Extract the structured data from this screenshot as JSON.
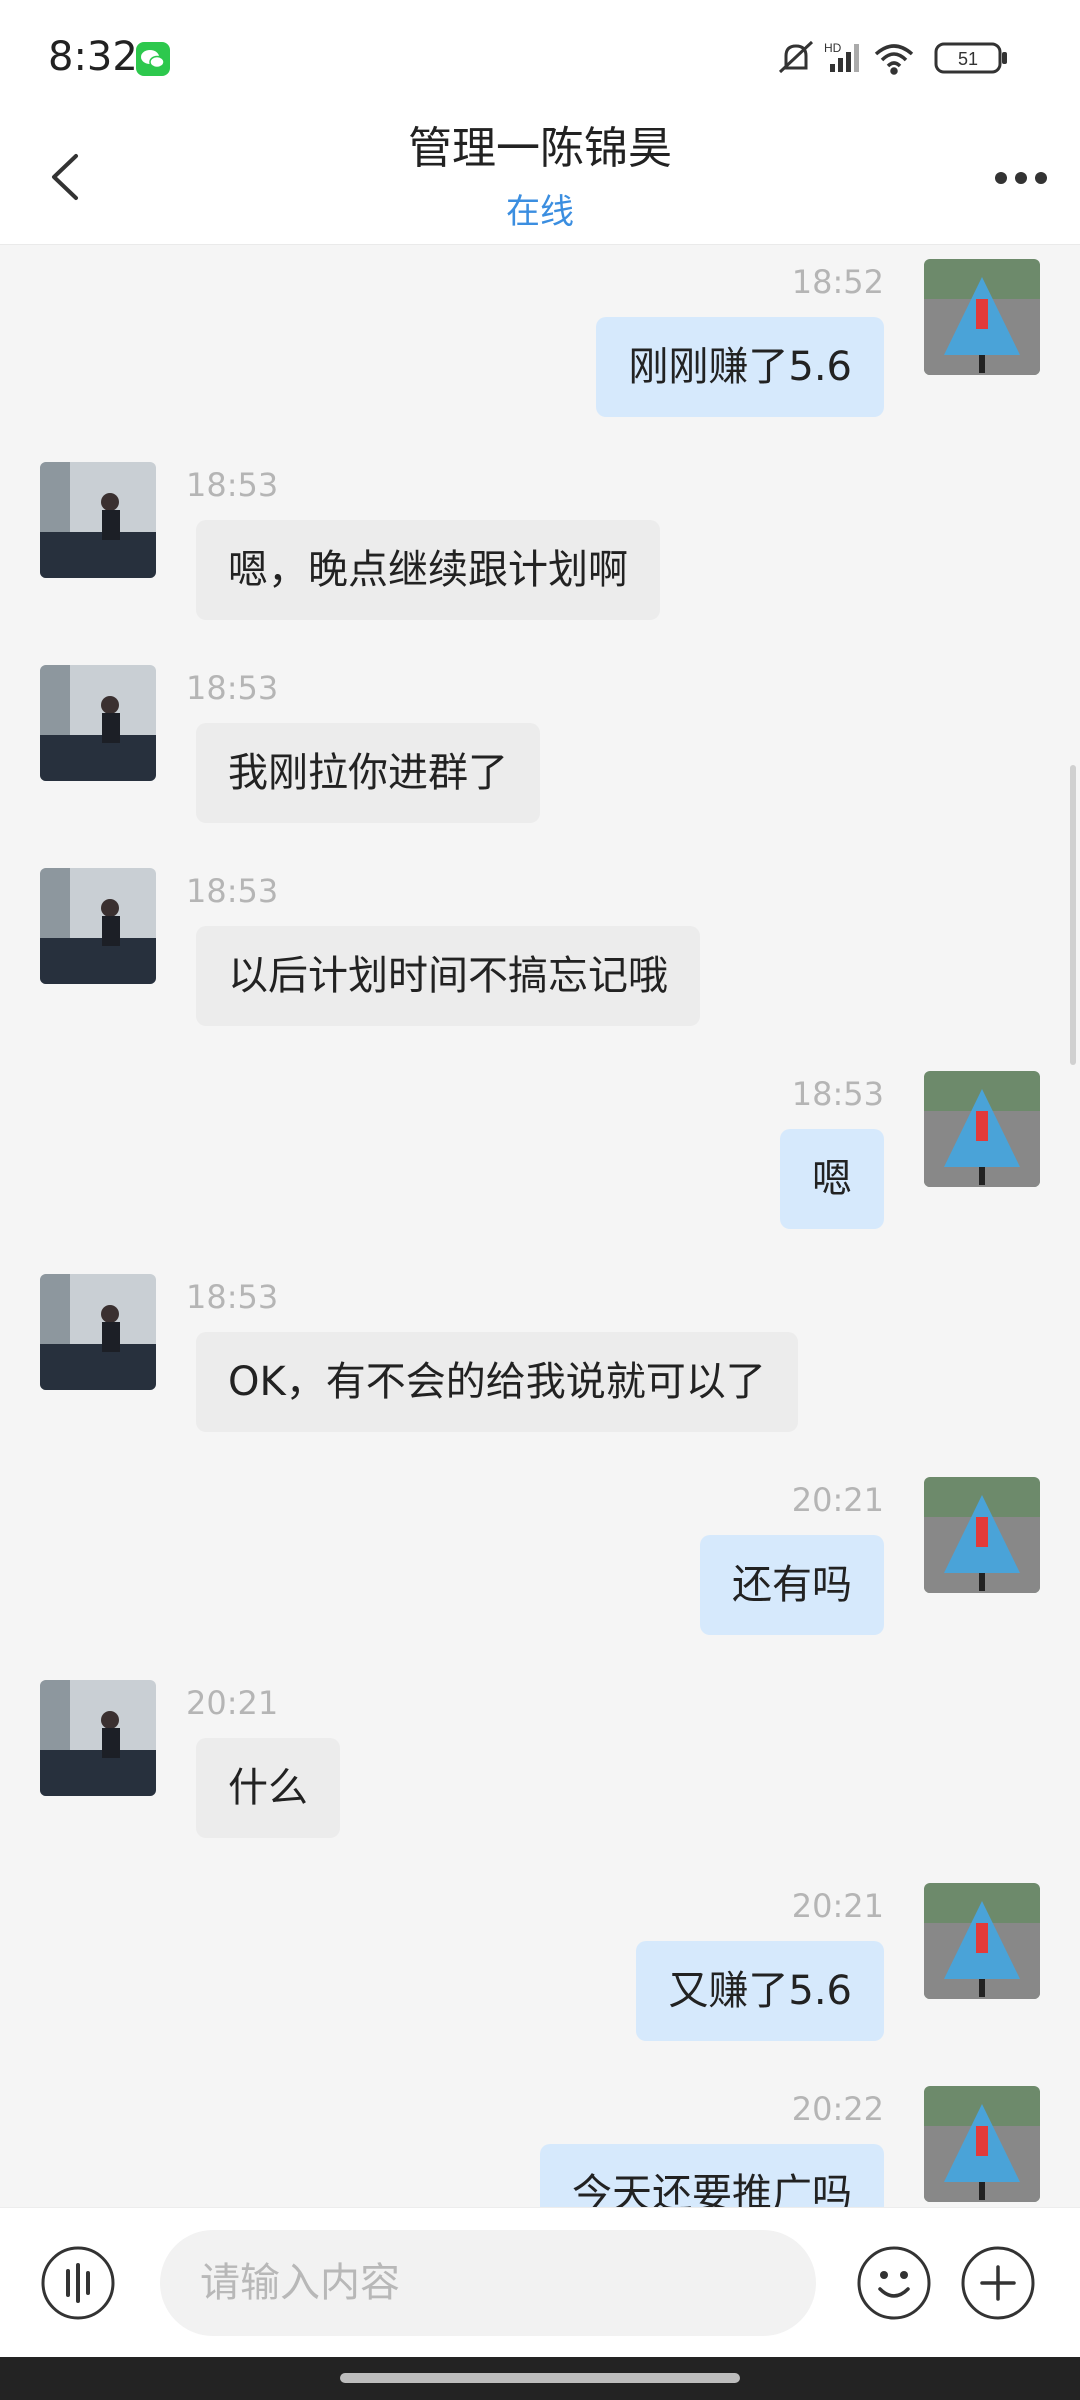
{
  "status": {
    "time": "8:32",
    "battery": "51",
    "network": "HD"
  },
  "header": {
    "title": "管理一陈锦昊",
    "subtitle": "在线"
  },
  "messages": [
    {
      "side": "right",
      "time": "18:52",
      "text": "刚刚赚了5.6"
    },
    {
      "side": "left",
      "time": "18:53",
      "text": "嗯，晚点继续跟计划啊"
    },
    {
      "side": "left",
      "time": "18:53",
      "text": "我刚拉你进群了"
    },
    {
      "side": "left",
      "time": "18:53",
      "text": "以后计划时间不搞忘记哦"
    },
    {
      "side": "right",
      "time": "18:53",
      "text": "嗯"
    },
    {
      "side": "left",
      "time": "18:53",
      "text": "OK，有不会的给我说就可以了"
    },
    {
      "side": "right",
      "time": "20:21",
      "text": "还有吗"
    },
    {
      "side": "left",
      "time": "20:21",
      "text": "什么"
    },
    {
      "side": "right",
      "time": "20:21",
      "text": "又赚了5.6"
    },
    {
      "side": "right",
      "time": "20:22",
      "text": "今天还要推广吗"
    }
  ],
  "input": {
    "placeholder": "请输入内容"
  },
  "icons": {
    "back": "back-arrow-icon",
    "more": "more-dots-icon",
    "voice": "voice-icon",
    "emoji": "emoji-icon",
    "plus": "plus-icon",
    "mute": "mute-icon",
    "signal": "signal-icon",
    "wifi": "wifi-icon",
    "battery": "battery-icon",
    "wechat": "wechat-icon"
  },
  "colors": {
    "accent": "#3b8ee0",
    "self_bubble": "#d6e9fc",
    "other_bubble": "#ececec",
    "wechat_green": "#2dc84d"
  }
}
